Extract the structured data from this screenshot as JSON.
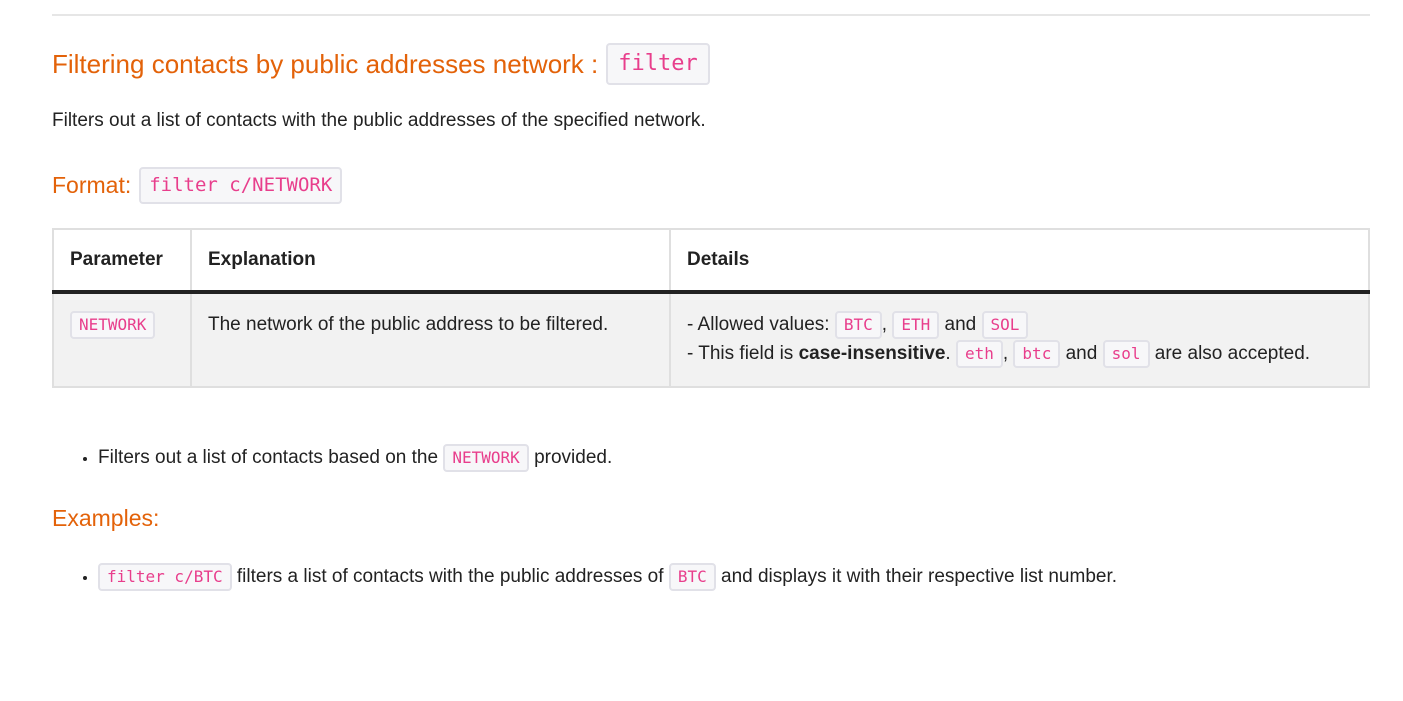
{
  "heading": {
    "text": "Filtering contacts by public addresses network :",
    "code": "filter"
  },
  "description": "Filters out a list of contacts with the public addresses of the specified network.",
  "format": {
    "label": "Format:",
    "code": "filter c/NETWORK"
  },
  "table": {
    "headers": [
      "Parameter",
      "Explanation",
      "Details"
    ],
    "row": {
      "parameter": "NETWORK",
      "explanation": "The network of the public address to be filtered.",
      "details_line1_prefix": "- Allowed values:",
      "allowed_values": [
        "BTC",
        "ETH",
        "SOL"
      ],
      "comma": ",",
      "and": "and",
      "details_line2_prefix": "- This field is",
      "details_line2_bold": "case-insensitive",
      "period": ".",
      "lowercase_values": [
        "eth",
        "btc",
        "sol"
      ],
      "details_line2_suffix": "are also accepted."
    }
  },
  "bullet1": {
    "prefix": "Filters out a list of contacts based on the",
    "code": "NETWORK",
    "suffix": "provided."
  },
  "examples": {
    "label": "Examples:",
    "items": [
      {
        "code": "filter c/BTC",
        "text1": "filters a list of contacts with the public addresses of",
        "code2": "BTC",
        "text2": "and displays it with their respective list number."
      }
    ]
  }
}
